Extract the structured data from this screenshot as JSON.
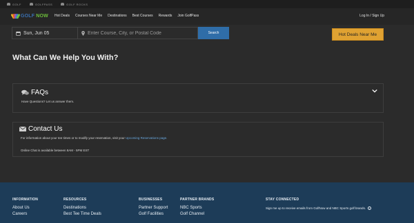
{
  "topbar": {
    "brands": [
      "GOLF",
      "GOLFPASS",
      "GOLF ROCKS"
    ]
  },
  "nav": {
    "logo_golf": "GOLF",
    "logo_now": "NOW",
    "links": [
      "Hot Deals",
      "Courses Near Me",
      "Destinations",
      "Best Courses",
      "Rewards",
      "Join GolfPass"
    ],
    "account": "Log In / Sign Up"
  },
  "search": {
    "date": "Sun, Jun 05",
    "location_placeholder": "Enter Course, City, or Postal Code",
    "search_label": "Search",
    "hot_deals_label": "Hot Deals Near Me"
  },
  "main": {
    "heading": "What Can We Help You With?",
    "faq": {
      "title": "FAQs",
      "subtitle": "Have Questions? Let us answer them."
    },
    "contact": {
      "title": "Contact Us",
      "line1_prefix": "For information about your tee times or to modify your reservation, visit your ",
      "line1_link": "Upcoming Reservations page.",
      "line2": "Online Chat is available between 8AM - 5PM EST"
    }
  },
  "footer": {
    "information": {
      "heading": "INFORMATION",
      "items": [
        "About Us",
        "Careers"
      ]
    },
    "resources": {
      "heading": "RESOURCES",
      "items": [
        "Destinations",
        "Best Tee Time Deals"
      ]
    },
    "businesses": {
      "heading": "BUSINESSES",
      "items": [
        "Partner Support",
        "Golf Facilities"
      ]
    },
    "partner_brands": {
      "heading": "PARTNER BRANDS",
      "items": [
        "NBC Sports",
        "Golf Channel"
      ]
    },
    "stay_connected": {
      "heading": "STAY CONNECTED",
      "text": "Sign me up to receive emails from GolfNow and NBC Sports golf brands."
    }
  },
  "colors": {
    "background": "#2b2b2b",
    "search_button": "#2f6da8",
    "hot_deals_button": "#e0a232",
    "footer": "#1d3c58",
    "link": "#6aa9e0"
  },
  "icons": [
    "peacock-logo-icon",
    "calendar-icon",
    "map-pin-icon",
    "chat-bubbles-icon",
    "envelope-icon",
    "chevron-down-icon",
    "info-icon"
  ]
}
